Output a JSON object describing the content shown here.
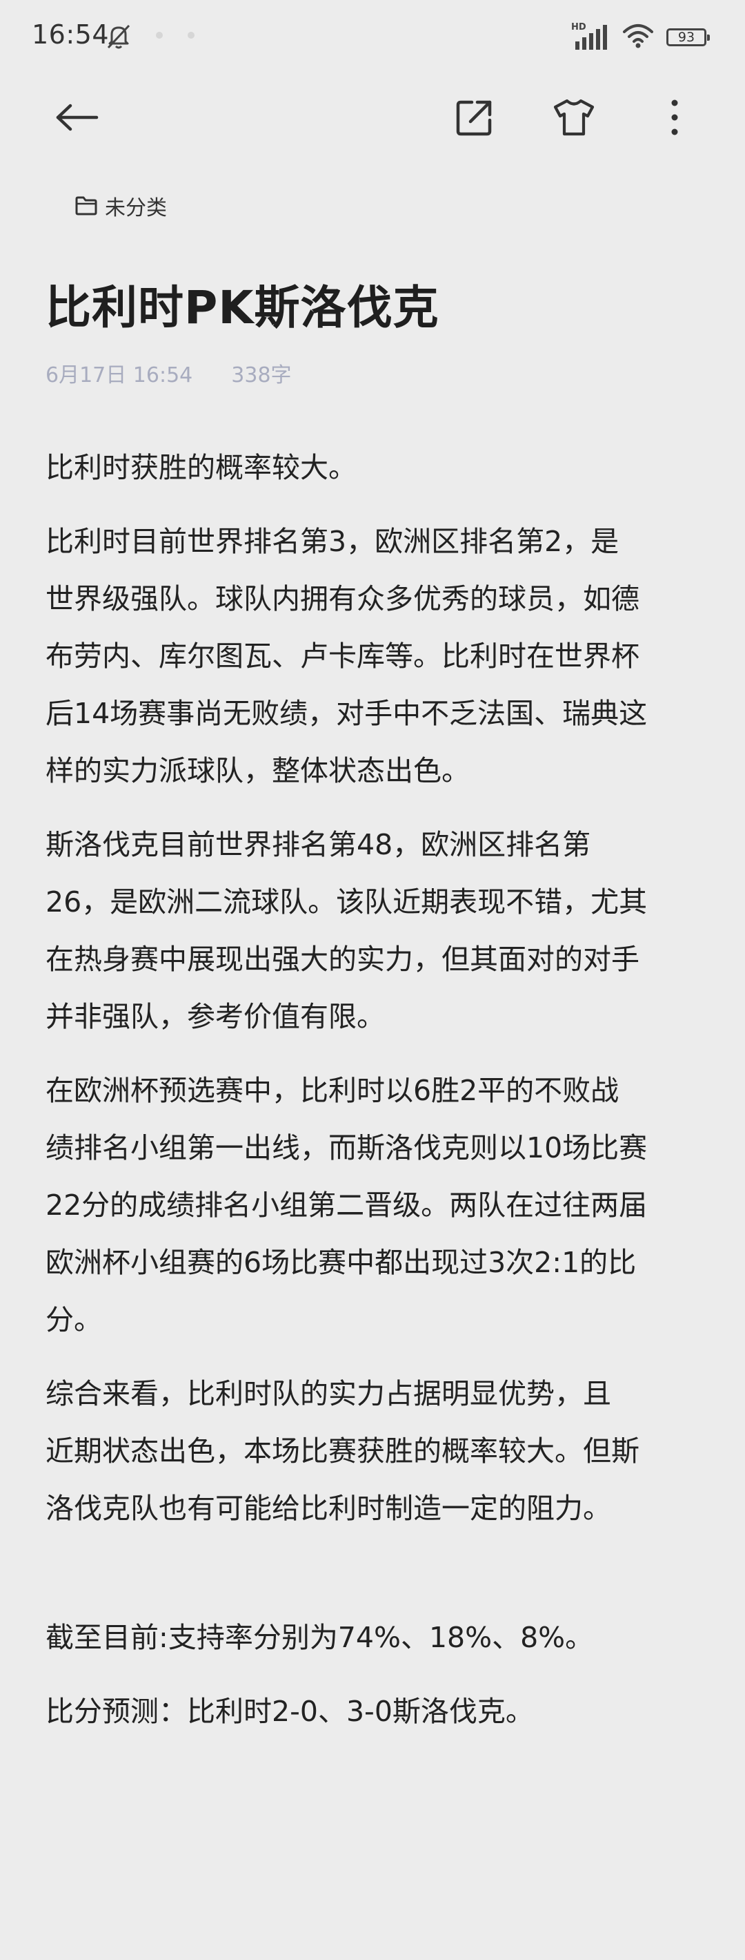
{
  "status_bar": {
    "time": "16:54",
    "network_label": "HD",
    "battery": "93"
  },
  "toolbar": {
    "back_icon": "arrow-left-icon",
    "share_icon": "share-external-icon",
    "theme_icon": "shirt-icon",
    "more_icon": "more-vertical-icon"
  },
  "note": {
    "folder": "未分类",
    "title": "比利时PK斯洛伐克",
    "date": "6月17日 16:54",
    "word_count": "338字",
    "body": {
      "p1": "比利时获胜的概率较大。",
      "p2": [
        " 比利时目前世界排名第3，欧洲区排名第2，是",
        "世界级强队。球队内拥有众多优秀的球员，如德",
        "布劳内、库尔图瓦、卢卡库等。比利时在世界杯",
        "后14场赛事尚无败绩，对手中不乏法国、瑞典这",
        "样的实力派球队，整体状态出色。"
      ],
      "p3": [
        " 斯洛伐克目前世界排名第48，欧洲区排名第",
        "26，是欧洲二流球队。该队近期表现不错，尤其",
        "在热身赛中展现出强大的实力，但其面对的对手",
        "并非强队，参考价值有限。"
      ],
      "p4": [
        " 在欧洲杯预选赛中，比利时以6胜2平的不败战",
        "绩排名小组第一出线，而斯洛伐克则以10场比赛",
        "22分的成绩排名小组第二晋级。两队在过往两届",
        "欧洲杯小组赛的6场比赛中都出现过3次2:1的比",
        "分。"
      ],
      "p5": [
        " 综合来看，比利时队的实力占据明显优势，且",
        "近期状态出色，本场比赛获胜的概率较大。但斯",
        "洛伐克队也有可能给比利时制造一定的阻力。"
      ],
      "p6": "截至目前:支持率分别为74%、18%、8%。",
      "p7": " 比分预测：比利时2-0、3-0斯洛伐克。"
    }
  }
}
